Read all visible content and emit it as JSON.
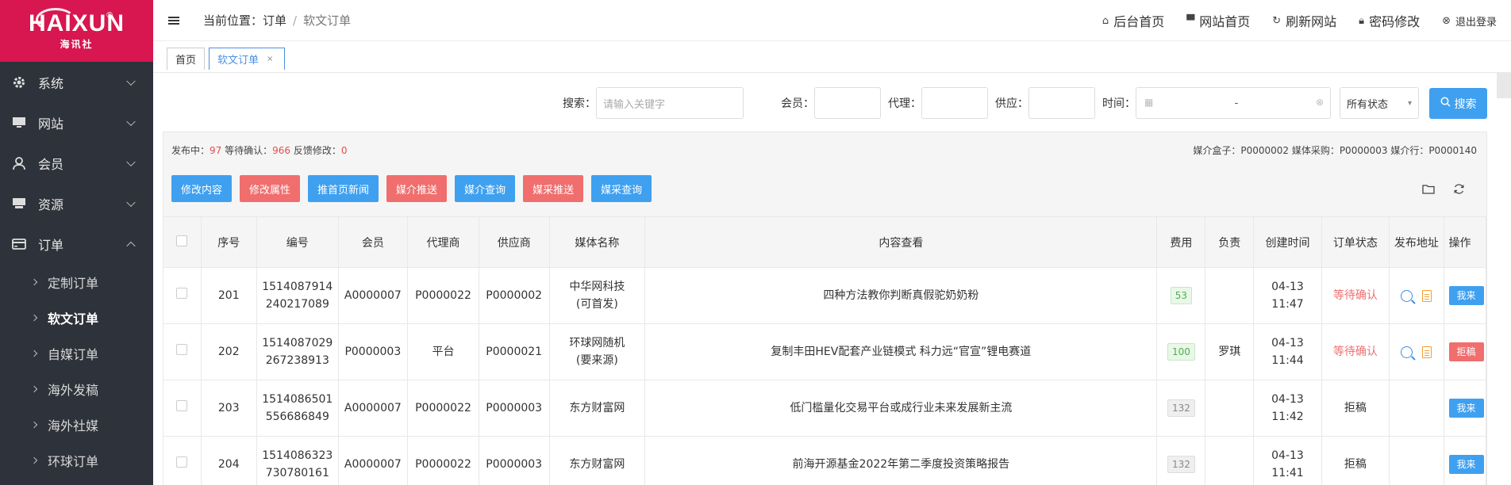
{
  "logo": {
    "text": "HAIXUN",
    "sub": "海讯社",
    "reg": "®"
  },
  "sidebar": {
    "items": [
      {
        "label": "系统",
        "icon": "gear-icon"
      },
      {
        "label": "网站",
        "icon": "monitor-icon"
      },
      {
        "label": "会员",
        "icon": "user-icon"
      },
      {
        "label": "资源",
        "icon": "drive-icon"
      },
      {
        "label": "订单",
        "icon": "card-icon",
        "expanded": true
      }
    ],
    "subitems": [
      {
        "label": "定制订单"
      },
      {
        "label": "软文订单",
        "active": true
      },
      {
        "label": "自媒订单"
      },
      {
        "label": "海外发稿"
      },
      {
        "label": "海外社媒"
      },
      {
        "label": "环球订单"
      }
    ]
  },
  "header": {
    "breadcrumb_prefix": "当前位置：",
    "breadcrumb_parent": "订单",
    "breadcrumb_sep": "/",
    "breadcrumb_current": "软文订单",
    "links": [
      {
        "label": "后台首页",
        "icon": "home-icon"
      },
      {
        "label": "网站首页",
        "icon": "monitor-icon"
      },
      {
        "label": "刷新网站",
        "icon": "refresh-icon"
      },
      {
        "label": "密码修改",
        "icon": "lock-icon"
      },
      {
        "label": "退出登录",
        "icon": "logout-icon"
      }
    ]
  },
  "tabs": {
    "home": "首页",
    "current": "软文订单",
    "close": "×"
  },
  "search": {
    "label": "搜索：",
    "placeholder": "请输入关键字",
    "member_label": "会员：",
    "agent_label": "代理：",
    "supplier_label": "供应：",
    "time_label": "时间：",
    "date_sep": "-",
    "status_select": "所有状态",
    "button": "搜索"
  },
  "stats": {
    "publishing_label": "发布中：",
    "publishing": "97",
    "waiting_label": "等待确认：",
    "waiting": "966",
    "feedback_label": "反馈修改：",
    "feedback": "0",
    "right": "媒介盒子：P0000002 媒体采购：P0000003 媒介行：P0000140"
  },
  "actions": [
    {
      "label": "修改内容",
      "color": "blue"
    },
    {
      "label": "修改属性",
      "color": "red"
    },
    {
      "label": "推首页新闻",
      "color": "blue"
    },
    {
      "label": "媒介推送",
      "color": "red"
    },
    {
      "label": "媒介查询",
      "color": "blue"
    },
    {
      "label": "媒采推送",
      "color": "red"
    },
    {
      "label": "媒采查询",
      "color": "blue"
    }
  ],
  "table": {
    "headers": [
      "序号",
      "编号",
      "会员",
      "代理商",
      "供应商",
      "媒体名称",
      "内容查看",
      "费用",
      "负责",
      "创建时间",
      "订单状态",
      "发布地址",
      "操作"
    ],
    "rows": [
      {
        "seq": "201",
        "id1": "1514087914",
        "id2": "240217089",
        "member": "A0000007",
        "agent": "P0000022",
        "supplier": "P0000002",
        "media1": "中华网科技",
        "media2": "(可首发)",
        "content": "四种方法教你判断真假驼奶奶粉",
        "fee": "53",
        "fee_style": "green",
        "owner": "",
        "created": "04-13 11:47",
        "status": "等待确认",
        "status_style": "wait",
        "has_links": true,
        "op": "我来",
        "op_style": "blue"
      },
      {
        "seq": "202",
        "id1": "1514087029",
        "id2": "267238913",
        "member": "P0000003",
        "agent": "平台",
        "supplier": "P0000021",
        "media1": "环球网随机",
        "media2": "(要来源)",
        "content": "复制丰田HEV配套产业链模式 科力远“官宣”锂电赛道",
        "fee": "100",
        "fee_style": "green",
        "owner": "罗琪",
        "created": "04-13 11:44",
        "status": "等待确认",
        "status_style": "wait",
        "has_links": true,
        "op": "拒稿",
        "op_style": "red"
      },
      {
        "seq": "203",
        "id1": "1514086501",
        "id2": "556686849",
        "member": "A0000007",
        "agent": "P0000022",
        "supplier": "P0000003",
        "media1": "东方财富网",
        "media2": "",
        "content": "低门槛量化交易平台或成行业未来发展新主流",
        "fee": "132",
        "fee_style": "gray",
        "owner": "",
        "created": "04-13 11:42",
        "status": "拒稿",
        "status_style": "normal",
        "has_links": false,
        "op": "我来",
        "op_style": "blue"
      },
      {
        "seq": "204",
        "id1": "1514086323",
        "id2": "730780161",
        "member": "A0000007",
        "agent": "P0000022",
        "supplier": "P0000003",
        "media1": "东方财富网",
        "media2": "",
        "content": "前海开源基金2022年第二季度投资策略报告",
        "fee": "132",
        "fee_style": "gray",
        "owner": "",
        "created": "04-13 11:41",
        "status": "拒稿",
        "status_style": "normal",
        "has_links": false,
        "op": "我来",
        "op_style": "blue"
      }
    ]
  }
}
